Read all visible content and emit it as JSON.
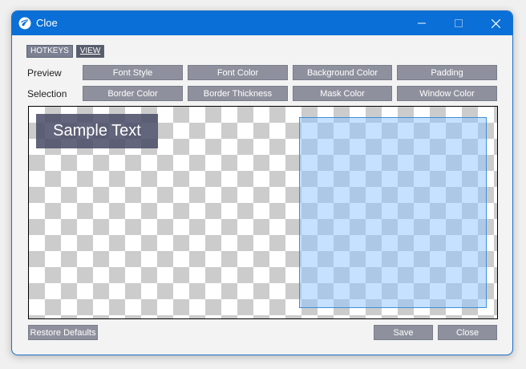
{
  "window": {
    "title": "Cloe",
    "accent_color": "#0a6fd6",
    "controls": [
      "minimize-icon",
      "maximize-icon",
      "close-icon"
    ]
  },
  "tabs": [
    {
      "label": "HOTKEYS",
      "active": false
    },
    {
      "label": "VIEW",
      "active": true
    }
  ],
  "rows": {
    "preview": {
      "label": "Preview",
      "buttons": [
        "Font Style",
        "Font Color",
        "Background Color",
        "Padding"
      ]
    },
    "selection": {
      "label": "Selection",
      "buttons": [
        "Border Color",
        "Border Thickness",
        "Mask Color",
        "Window Color"
      ]
    }
  },
  "preview_area": {
    "sample_text": "Sample Text",
    "selection_color": "#8cc3ff"
  },
  "footer": {
    "restore_label": "Restore Defaults",
    "save_label": "Save",
    "close_label": "Close"
  }
}
